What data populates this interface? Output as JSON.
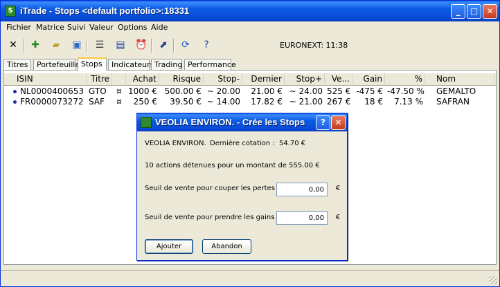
{
  "window": {
    "title": "iTrade - Stops <default portfolio>:18331",
    "app_icon": "itrade-logo-icon"
  },
  "menu": [
    "Fichier",
    "Matrice",
    "Suivi",
    "Valeur",
    "Options",
    "Aide"
  ],
  "toolbar": {
    "icons": [
      "close-icon",
      "add-icon",
      "open-icon",
      "save-icon",
      "list-icon",
      "book-icon",
      "alarm-icon",
      "chart-icon",
      "refresh-icon",
      "help-icon"
    ],
    "exchange_clock": "EURONEXT: 11:38"
  },
  "tabs": [
    "Titres",
    "Portefeuille",
    "Stops",
    "Indicateurs",
    "Trading",
    "Performance"
  ],
  "active_tab": "Stops",
  "table": {
    "columns": [
      "ISIN",
      "Titre",
      "",
      "Achat",
      "Risque",
      "Stop-",
      "Dernier",
      "Stop+",
      "Ve...",
      "Gain",
      "%",
      "Nom"
    ],
    "rows": [
      [
        "NL0000400653",
        "GTO",
        "¤",
        "1000 €",
        "500.00 €",
        "~ 20.00",
        "21.00 €",
        "~ 24.00",
        "525 €",
        "-475 €",
        "-47.50 %",
        "GEMALTO"
      ],
      [
        "FR0000073272",
        "SAF",
        "¤",
        "250 €",
        "39.50 €",
        "~ 14.00",
        "17.82 €",
        "~ 21.00",
        "267 €",
        "18 €",
        "7.13 %",
        "SAFRAN"
      ]
    ]
  },
  "dialog": {
    "title": "VEOLIA ENVIRON. - Crée les Stops",
    "stock_name": "VEOLIA ENVIRON.",
    "last_quote_label": "Dernière cotation :",
    "last_quote_value": "54.70 €",
    "holding_text": "10 actions détenues pour un montant de 555.00 €",
    "stop_loss_label": "Seuil de vente pour couper les pertes :",
    "stop_loss_value": "0,00",
    "take_profit_label": "Seuil de vente pour prendre les gains :",
    "take_profit_value": "0,00",
    "currency": "€",
    "add_button": "Ajouter",
    "cancel_button": "Abandon",
    "help_button": "?"
  }
}
